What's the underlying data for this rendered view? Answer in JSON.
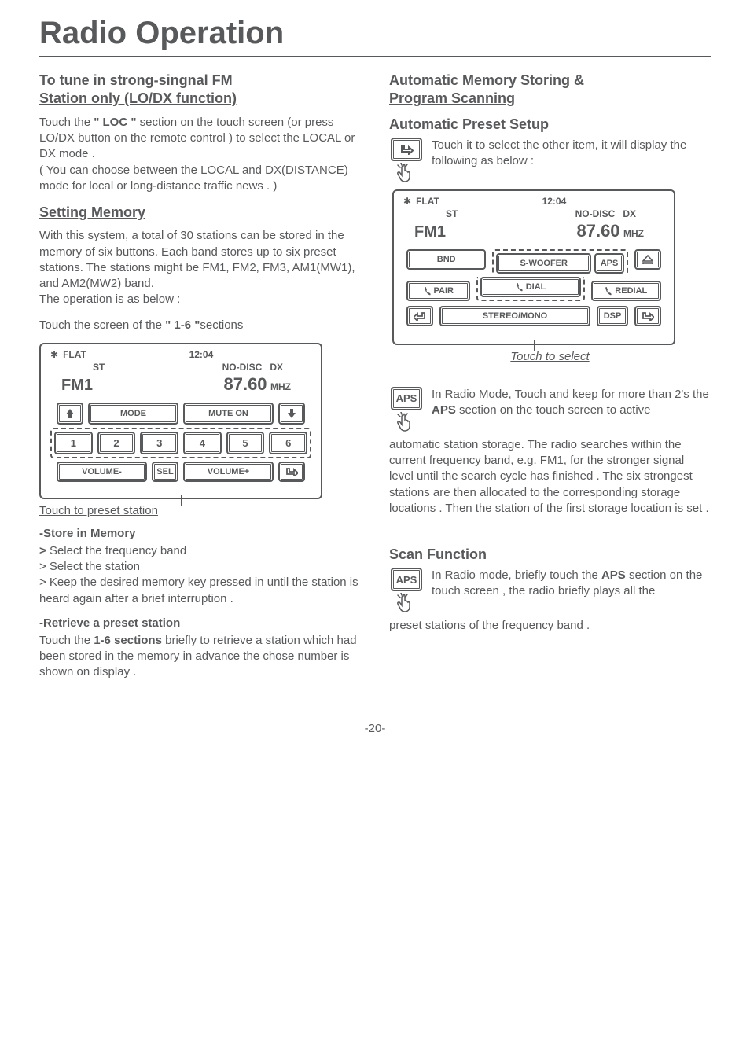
{
  "page_title": "Radio Operation",
  "page_number": "-20-",
  "left": {
    "h1_line1": "To tune in strong-singnal FM",
    "h1_line2": " Station only (LO/DX function)",
    "p1_a": "Touch the ",
    "p1_bold": "\" LOC \"",
    "p1_b": " section on the touch screen (or press LO/DX button on the remote control ) to select the LOCAL or DX mode .",
    "p1_c": "( You can choose between the LOCAL and DX(DISTANCE)  mode for local or long-distance traffic news . )",
    "h2": "Setting Memory",
    "p2": "With this system, a total of 30 stations can be stored in the memory of six buttons. Each band stores up to six preset stations. The stations might be FM1,  FM2,  FM3,  AM1(MW1), and AM2(MW2) band.",
    "p2b": "The operation is as below :",
    "p3_a": "Touch the screen of the ",
    "p3_bold": "\" 1-6 \"",
    "p3_b": "sections",
    "touch_preset": "Touch to preset station",
    "store_h": "-Store in Memory",
    "store_l1": "> Select the frequency band",
    "store_l2": "> Select the station",
    "store_l3": "> Keep the desired memory key pressed in until the station is heard again after a brief interruption .",
    "retrieve_h": "-Retrieve a preset station",
    "retrieve_a": "Touch the ",
    "retrieve_bold": "1-6 sections",
    "retrieve_b": " briefly to retrieve a station which had been stored in the memory in advance the chose number is shown on display ."
  },
  "right": {
    "h1_line1": "Automatic Memory Storing &",
    "h1_line2": "Program Scanning",
    "sub1": "Automatic Preset Setup",
    "p1": "Touch it to select the other item, it will display the following as below :",
    "touch_select": "Touch to select",
    "aps_label": "APS",
    "p2_a": "In Radio Mode, Touch and keep for more than 2's the ",
    "p2_bold": "APS",
    "p2_b": " section on the touch screen to active",
    "p3": "automatic station storage. The radio searches within the current frequency band, e.g. FM1, for the stronger signal level until the search cycle has finished . The six strongest stations are then allocated to the corresponding storage locations . Then the station of the first storage location is set .",
    "sub2": "Scan Function",
    "p4_a": "In Radio mode, briefly touch the ",
    "p4_bold": "APS",
    "p4_b": " section on the touch screen , the radio briefly plays all the",
    "p5": "preset stations of the frequency band ."
  },
  "screen1": {
    "bt": "✱",
    "flat": "FLAT",
    "time": "12:04",
    "st": "ST",
    "nodisc": "NO-DISC",
    "dx": "DX",
    "band": "FM1",
    "freq": "87.60",
    "unit": "MHZ",
    "mode": "MODE",
    "muteon": "MUTE ON",
    "nums": [
      "1",
      "2",
      "3",
      "4",
      "5",
      "6"
    ],
    "volm": "VOLUME-",
    "sel": "SEL",
    "volp": "VOLUME+"
  },
  "screen2": {
    "bt": "✱",
    "flat": "FLAT",
    "time": "12:04",
    "st": "ST",
    "nodisc": "NO-DISC",
    "dx": "DX",
    "band": "FM1",
    "freq": "87.60",
    "unit": "MHZ",
    "bnd": "BND",
    "swoofer": "S-WOOFER",
    "aps": "APS",
    "pair": "PAIR",
    "dial": "DIAL",
    "redial": "REDIAL",
    "stereo": "STEREO/MONO",
    "dsp": "DSP"
  }
}
